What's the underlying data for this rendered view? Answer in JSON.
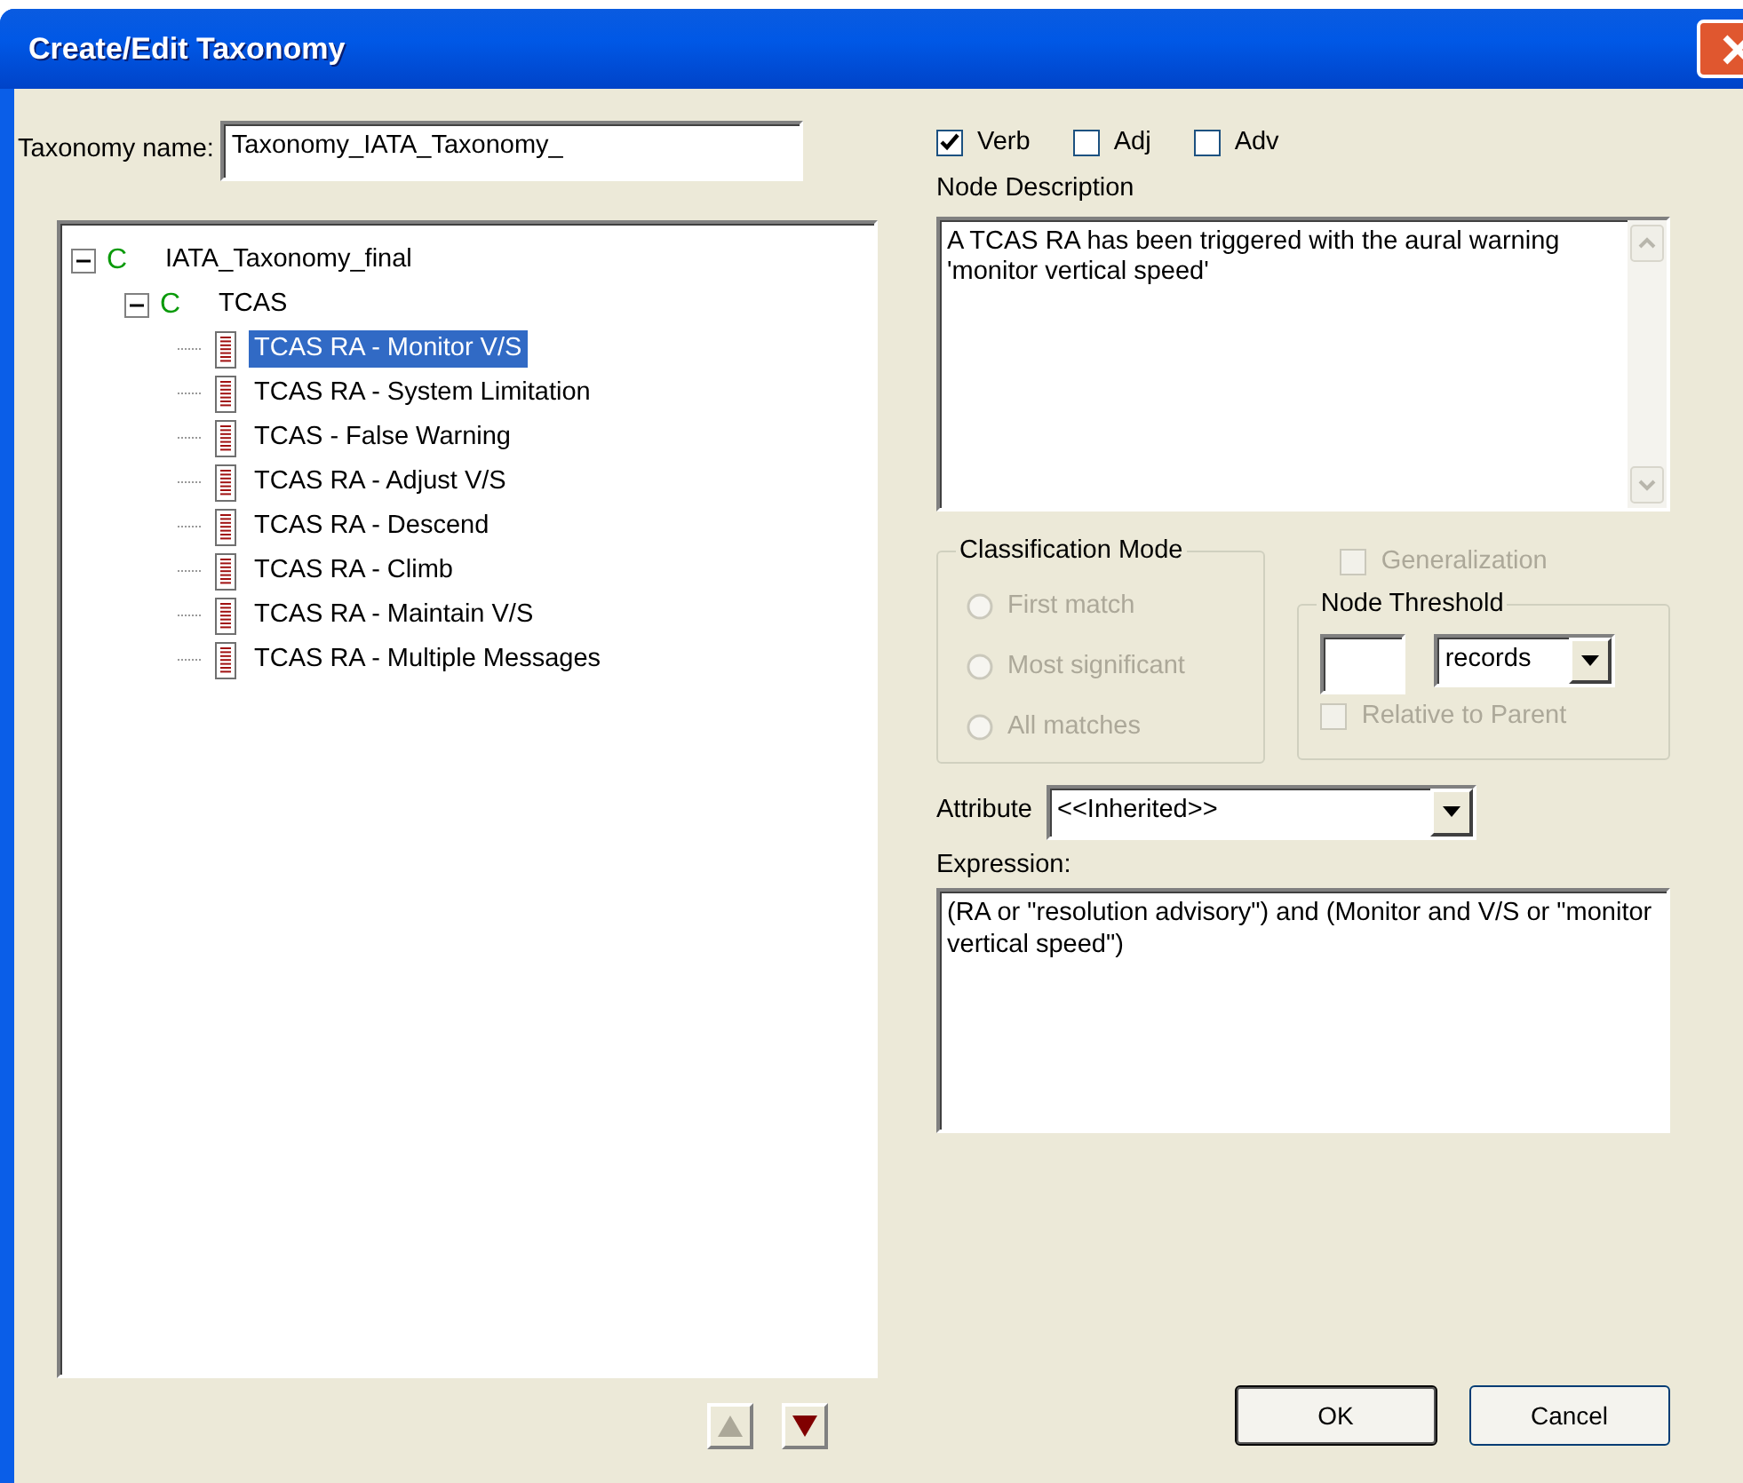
{
  "window": {
    "title": "Create/Edit Taxonomy"
  },
  "taxonomy_name": {
    "label": "Taxonomy name:",
    "value": "Taxonomy_IATA_Taxonomy_"
  },
  "tree": [
    {
      "label": "IATA_Taxonomy_final",
      "kind": "category",
      "marker": "C",
      "expanded": true,
      "selected": false,
      "children": [
        {
          "label": "TCAS",
          "kind": "category",
          "marker": "C",
          "expanded": true,
          "selected": false,
          "children": [
            {
              "label": "TCAS RA - Monitor V/S",
              "kind": "node",
              "selected": true
            },
            {
              "label": "TCAS RA - System Limitation",
              "kind": "node",
              "selected": false
            },
            {
              "label": "TCAS - False Warning",
              "kind": "node",
              "selected": false
            },
            {
              "label": "TCAS RA - Adjust V/S",
              "kind": "node",
              "selected": false
            },
            {
              "label": "TCAS RA - Descend",
              "kind": "node",
              "selected": false
            },
            {
              "label": "TCAS RA - Climb",
              "kind": "node",
              "selected": false
            },
            {
              "label": "TCAS RA - Maintain V/S",
              "kind": "node",
              "selected": false
            },
            {
              "label": "TCAS RA - Multiple Messages",
              "kind": "node",
              "selected": false
            }
          ]
        }
      ]
    }
  ],
  "move_buttons": [
    {
      "kind": "up",
      "disabled": true
    },
    {
      "kind": "down",
      "disabled": false
    }
  ],
  "word_types": [
    {
      "label": "Verb",
      "checked": true
    },
    {
      "label": "Adj",
      "checked": false
    },
    {
      "label": "Adv",
      "checked": false
    }
  ],
  "node_description": {
    "label": "Node Description",
    "value": "A TCAS RA has been triggered with the aural warning 'monitor vertical speed'"
  },
  "classification_mode": {
    "label": "Classification Mode",
    "disabled": true,
    "options": [
      {
        "label": "First match",
        "selected": false
      },
      {
        "label": "Most significant",
        "selected": false
      },
      {
        "label": "All matches",
        "selected": false
      }
    ]
  },
  "generalization": {
    "label": "Generalization",
    "checked": false,
    "disabled": true
  },
  "node_threshold": {
    "label": "Node Threshold",
    "unit": "records",
    "relative_to_parent": {
      "label": "Relative to Parent",
      "checked": false,
      "disabled": true
    }
  },
  "attribute": {
    "label": "Attribute",
    "value": "<<Inherited>>"
  },
  "expression": {
    "label": "Expression:",
    "value": "(RA or \"resolution advisory\") and (Monitor and V/S or \"monitor vertical speed\")"
  },
  "buttons": [
    {
      "label": "OK",
      "default": true
    },
    {
      "label": "Cancel",
      "default": false
    }
  ]
}
